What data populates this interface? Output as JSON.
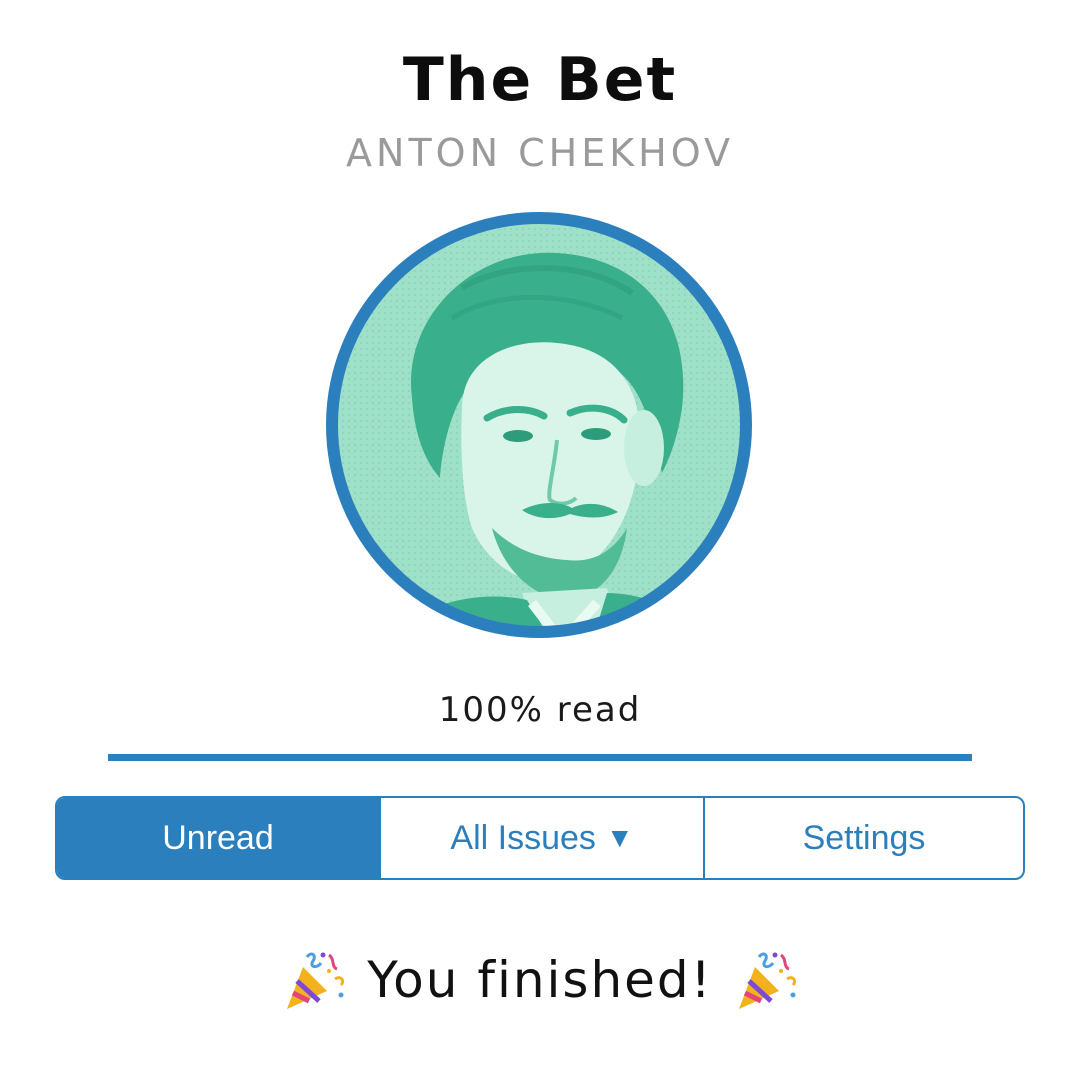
{
  "book": {
    "title": "The Bet",
    "author": "ANTON CHEKHOV"
  },
  "portrait": {
    "icon": "author-portrait",
    "tint": "#4fc7a1",
    "ring_color": "#2c7fbd"
  },
  "progress": {
    "label": "100% read",
    "fraction": 1.0,
    "color": "#2c7fbd"
  },
  "tabs": [
    {
      "label": "Unread",
      "active": true
    },
    {
      "label": "All Issues",
      "active": false,
      "icon": "triangle-down-icon",
      "icon_glyph": "▼"
    },
    {
      "label": "Settings",
      "active": false
    }
  ],
  "completion": {
    "message": "You finished!",
    "icon": "party-popper-icon"
  },
  "colors": {
    "accent": "#2c7fbd",
    "title": "#0d0d0d",
    "author": "#9a9a9a"
  }
}
